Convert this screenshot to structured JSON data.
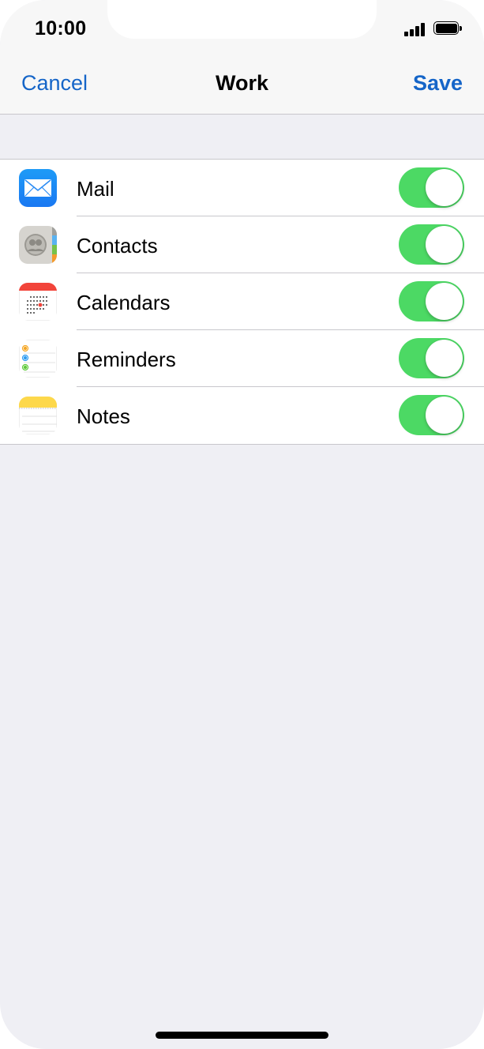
{
  "status_bar": {
    "time": "10:00",
    "signal_icon": "cellular-signal-icon",
    "battery_icon": "battery-icon"
  },
  "nav": {
    "cancel_label": "Cancel",
    "title": "Work",
    "save_label": "Save"
  },
  "colors": {
    "accent": "#1565c8",
    "toggle_on": "#4cd964",
    "background": "#efeff4",
    "separator": "#c8c7cc"
  },
  "services": [
    {
      "label": "Mail",
      "icon": "mail-icon",
      "enabled": true
    },
    {
      "label": "Contacts",
      "icon": "contacts-icon",
      "enabled": true
    },
    {
      "label": "Calendars",
      "icon": "calendar-icon",
      "enabled": true
    },
    {
      "label": "Reminders",
      "icon": "reminders-icon",
      "enabled": true
    },
    {
      "label": "Notes",
      "icon": "notes-icon",
      "enabled": true
    }
  ]
}
